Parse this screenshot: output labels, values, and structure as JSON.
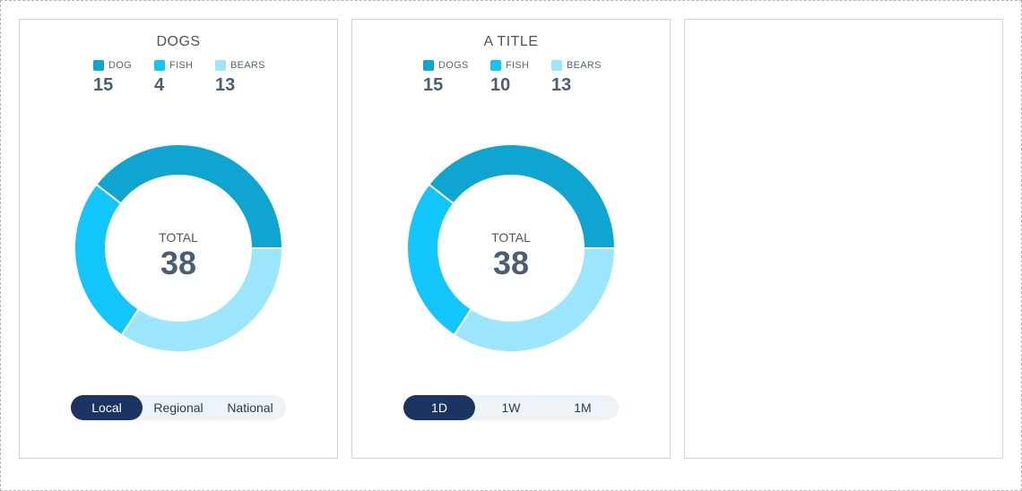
{
  "colors": {
    "dogs": "#0fa5d1",
    "fish": "#12c6fb",
    "bears": "#9be6fc",
    "active_toggle": "#1c3461"
  },
  "cards": [
    {
      "title": "DOGS",
      "legend": [
        {
          "label": "DOG",
          "value": "15"
        },
        {
          "label": "FISH",
          "value": "4"
        },
        {
          "label": "BEARS",
          "value": "13"
        }
      ],
      "total_label": "TOTAL",
      "total_value": "38",
      "toggle": [
        "Local",
        "Regional",
        "National"
      ],
      "active_toggle": "Local"
    },
    {
      "title": "A TITLE",
      "legend": [
        {
          "label": "DOGS",
          "value": "15"
        },
        {
          "label": "FISH",
          "value": "10"
        },
        {
          "label": "BEARS",
          "value": "13"
        }
      ],
      "total_label": "TOTAL",
      "total_value": "38",
      "toggle": [
        "1D",
        "1W",
        "1M"
      ],
      "active_toggle": "1D"
    }
  ],
  "chart_data": [
    {
      "type": "pie",
      "title": "DOGS",
      "categories": [
        "DOG",
        "FISH",
        "BEARS"
      ],
      "values": [
        15,
        10,
        13
      ],
      "center_label": "TOTAL",
      "center_value": 38
    },
    {
      "type": "pie",
      "title": "A TITLE",
      "categories": [
        "DOGS",
        "FISH",
        "BEARS"
      ],
      "values": [
        15,
        10,
        13
      ],
      "center_label": "TOTAL",
      "center_value": 38
    }
  ]
}
